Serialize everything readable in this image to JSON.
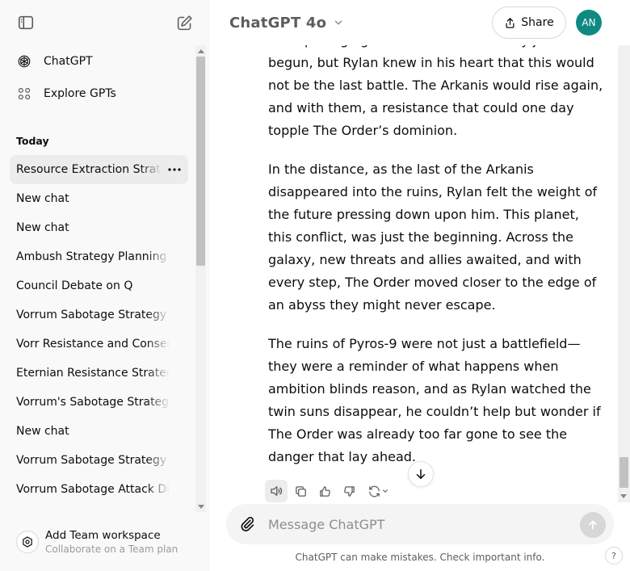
{
  "sidebar": {
    "nav": [
      {
        "label": "ChatGPT",
        "icon": "openai-logo-icon"
      },
      {
        "label": "Explore GPTs",
        "icon": "grid-icon"
      }
    ],
    "section_title": "Today",
    "chats": [
      {
        "label": "Resource Extraction Strategy",
        "active": true
      },
      {
        "label": "New chat"
      },
      {
        "label": "New chat"
      },
      {
        "label": "Ambush Strategy Planning"
      },
      {
        "label": "Council Debate on Q"
      },
      {
        "label": "Vorrum Sabotage Strategy Discussion"
      },
      {
        "label": "Vorr Resistance and Consequences"
      },
      {
        "label": "Eternian Resistance Strategy"
      },
      {
        "label": "Vorrum's Sabotage Strategy"
      },
      {
        "label": "New chat"
      },
      {
        "label": "Vorrum Sabotage Strategy Discussion"
      },
      {
        "label": "Vorrum Sabotage Attack Discussion"
      }
    ],
    "team": {
      "title": "Add Team workspace",
      "subtitle": "Collaborate on a Team plan"
    }
  },
  "header": {
    "model": "ChatGPT 4o",
    "share_label": "Share",
    "avatar_initials": "AN"
  },
  "messages": [
    "The uprising against The Order had only just begun, but Rylan knew in his heart that this would not be the last battle. The Arkanis would rise again, and with them, a resistance that could one day topple The Order’s dominion.",
    "In the distance, as the last of the Arkanis disappeared into the ruins, Rylan felt the weight of the future pressing down upon him. This planet, this conflict, was just the beginning. Across the galaxy, new threats and allies awaited, and with every step, The Order moved closer to the edge of an abyss they might never escape.",
    "The ruins of Pyros-9 were not just a battlefield—they were a reminder of what happens when ambition blinds reason, and as Rylan watched the twin suns disappear, he couldn’t help but wonder if The Order was already too far gone to see the danger that lay ahead."
  ],
  "composer": {
    "placeholder": "Message ChatGPT"
  },
  "disclaimer": "ChatGPT can make mistakes. Check important info.",
  "help_label": "?",
  "colors": {
    "avatar": "#0e8a82",
    "sidebar_bg": "#f9f9f9",
    "composer_bg": "#f4f4f4",
    "active_chat_bg": "#ececec"
  }
}
